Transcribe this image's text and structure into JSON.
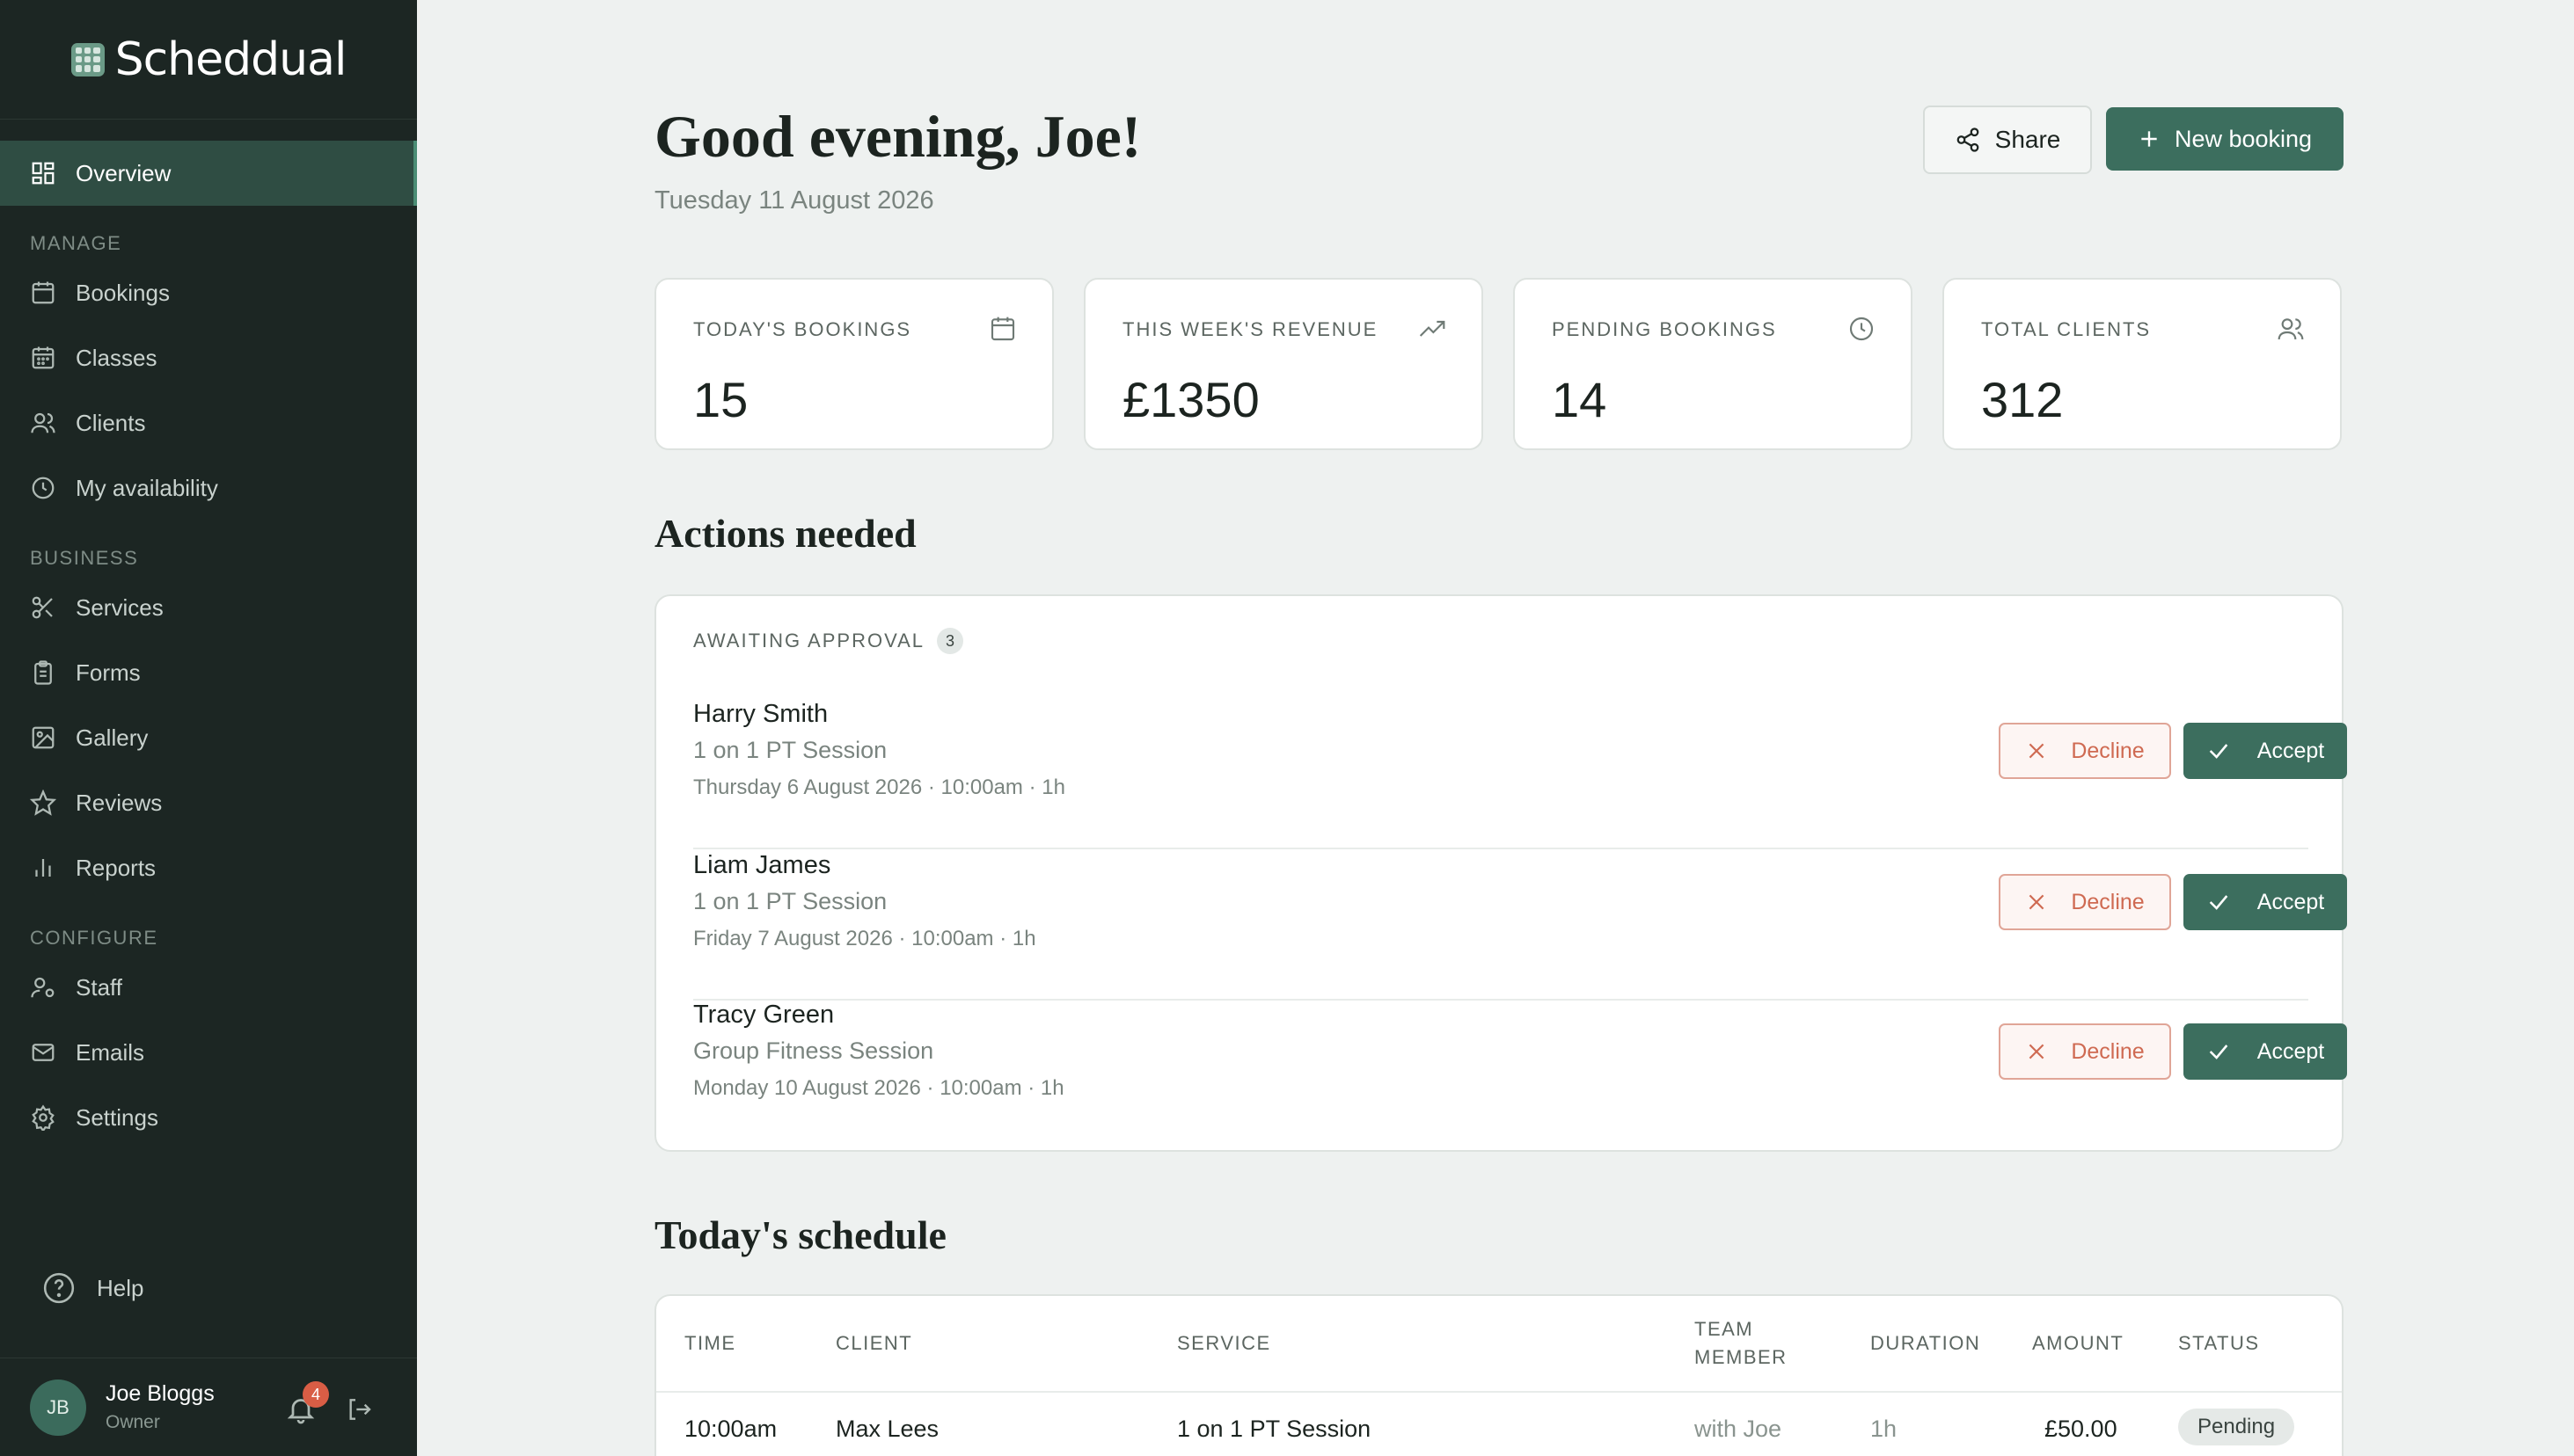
{
  "brand": {
    "name": "Scheddual"
  },
  "nav": {
    "overview": "Overview",
    "sections": {
      "manage": "MANAGE",
      "business": "BUSINESS",
      "configure": "CONFIGURE"
    },
    "manage": [
      "Bookings",
      "Classes",
      "Clients",
      "My availability"
    ],
    "business": [
      "Services",
      "Forms",
      "Gallery",
      "Reviews",
      "Reports"
    ],
    "configure": [
      "Staff",
      "Emails",
      "Settings"
    ],
    "help": "Help"
  },
  "user": {
    "initials": "JB",
    "name": "Joe Bloggs",
    "role": "Owner",
    "notifications": "4"
  },
  "header": {
    "greeting": "Good evening, Joe!",
    "date": "Tuesday 11 August 2026",
    "share_label": "Share",
    "new_booking_label": "New booking"
  },
  "stats": [
    {
      "label": "TODAY'S BOOKINGS",
      "value": "15",
      "icon": "calendar-icon"
    },
    {
      "label": "THIS WEEK'S REVENUE",
      "value": "£1350",
      "icon": "trending-up-icon"
    },
    {
      "label": "PENDING BOOKINGS",
      "value": "14",
      "icon": "clock-icon"
    },
    {
      "label": "TOTAL CLIENTS",
      "value": "312",
      "icon": "users-icon"
    }
  ],
  "actions": {
    "title": "Actions needed",
    "awaiting_label": "AWAITING APPROVAL",
    "awaiting_count": "3",
    "decline_label": "Decline",
    "accept_label": "Accept",
    "requests": [
      {
        "name": "Harry Smith",
        "service": "1 on 1 PT Session",
        "when": "Thursday 6 August 2026 · 10:00am · 1h"
      },
      {
        "name": "Liam James",
        "service": "1 on 1 PT Session",
        "when": "Friday 7 August 2026 · 10:00am · 1h"
      },
      {
        "name": "Tracy Green",
        "service": "Group Fitness Session",
        "when": "Monday 10 August 2026 · 10:00am · 1h"
      }
    ]
  },
  "schedule": {
    "title": "Today's schedule",
    "columns": {
      "time": "TIME",
      "client": "CLIENT",
      "service": "SERVICE",
      "team_1": "TEAM",
      "team_2": "MEMBER",
      "duration": "DURATION",
      "amount": "AMOUNT",
      "status": "STATUS"
    },
    "rows": [
      {
        "time": "10:00am",
        "client": "Max Lees",
        "service": "1 on 1 PT Session",
        "team": "with Joe",
        "duration": "1h",
        "amount": "£50.00",
        "status": "Pending"
      }
    ]
  },
  "colors": {
    "sidebar": "#1c2623",
    "accent": "#3c6e5e",
    "decline": "#cf6a52",
    "background": "#eef1f0"
  }
}
